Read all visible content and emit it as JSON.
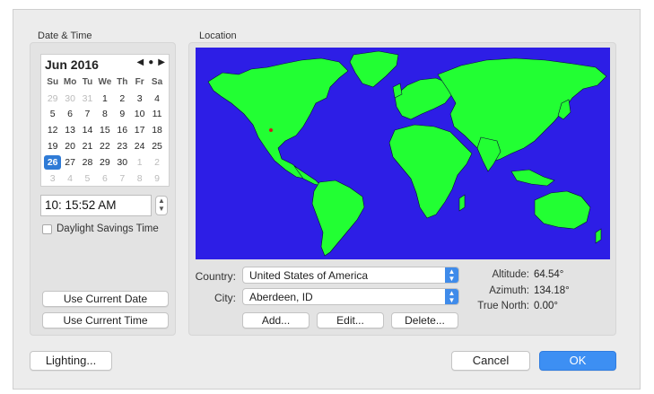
{
  "date_time": {
    "group_label": "Date & Time",
    "calendar": {
      "month_label": "Jun 2016",
      "nav_prev": "◀",
      "nav_today": "●",
      "nav_next": "▶",
      "weekdays": [
        "Su",
        "Mo",
        "Tu",
        "We",
        "Th",
        "Fr",
        "Sa"
      ],
      "weeks": [
        [
          {
            "d": "29",
            "dim": true
          },
          {
            "d": "30",
            "dim": true
          },
          {
            "d": "31",
            "dim": true
          },
          {
            "d": "1"
          },
          {
            "d": "2"
          },
          {
            "d": "3"
          },
          {
            "d": "4"
          }
        ],
        [
          {
            "d": "5"
          },
          {
            "d": "6"
          },
          {
            "d": "7"
          },
          {
            "d": "8"
          },
          {
            "d": "9"
          },
          {
            "d": "10"
          },
          {
            "d": "11"
          }
        ],
        [
          {
            "d": "12"
          },
          {
            "d": "13"
          },
          {
            "d": "14"
          },
          {
            "d": "15"
          },
          {
            "d": "16"
          },
          {
            "d": "17"
          },
          {
            "d": "18"
          }
        ],
        [
          {
            "d": "19"
          },
          {
            "d": "20"
          },
          {
            "d": "21"
          },
          {
            "d": "22"
          },
          {
            "d": "23"
          },
          {
            "d": "24"
          },
          {
            "d": "25"
          }
        ],
        [
          {
            "d": "26",
            "sel": true
          },
          {
            "d": "27"
          },
          {
            "d": "28"
          },
          {
            "d": "29"
          },
          {
            "d": "30"
          },
          {
            "d": "1",
            "dim": true
          },
          {
            "d": "2",
            "dim": true
          }
        ],
        [
          {
            "d": "3",
            "dim": true
          },
          {
            "d": "4",
            "dim": true
          },
          {
            "d": "5",
            "dim": true
          },
          {
            "d": "6",
            "dim": true
          },
          {
            "d": "7",
            "dim": true
          },
          {
            "d": "8",
            "dim": true
          },
          {
            "d": "9",
            "dim": true
          }
        ]
      ]
    },
    "time_value": "10: 15:52 AM",
    "daylight_savings_label": "Daylight Savings Time",
    "daylight_savings_checked": false,
    "use_current_date_label": "Use Current Date",
    "use_current_time_label": "Use Current Time"
  },
  "location": {
    "group_label": "Location",
    "map": {
      "ocean_color": "#2d1ee6",
      "land_color": "#22ff33",
      "marker_color": "#d21a1a"
    },
    "country_label": "Country:",
    "country_value": "United States of America",
    "city_label": "City:",
    "city_value": "Aberdeen, ID",
    "add_label": "Add...",
    "edit_label": "Edit...",
    "delete_label": "Delete...",
    "altitude_label": "Altitude:",
    "altitude_value": "64.54°",
    "azimuth_label": "Azimuth:",
    "azimuth_value": "134.18°",
    "true_north_label": "True North:",
    "true_north_value": "0.00°"
  },
  "footer": {
    "lighting_label": "Lighting...",
    "cancel_label": "Cancel",
    "ok_label": "OK"
  },
  "colors": {
    "accent": "#3d8ff3",
    "selected_day": "#2f7bd6"
  }
}
